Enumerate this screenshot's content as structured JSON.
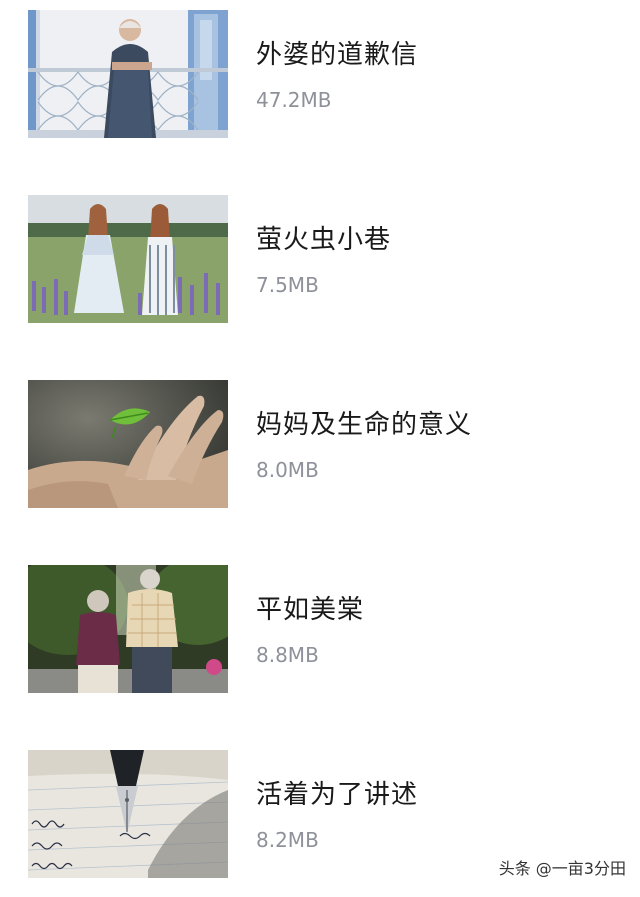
{
  "items": [
    {
      "title": "外婆的道歉信",
      "size": "47.2MB",
      "thumb_icon": "grandmother-balcony-photo"
    },
    {
      "title": "萤火虫小巷",
      "size": "7.5MB",
      "thumb_icon": "two-girls-lavender-photo"
    },
    {
      "title": "妈妈及生命的意义",
      "size": "8.0MB",
      "thumb_icon": "hand-leaf-photo"
    },
    {
      "title": "平如美棠",
      "size": "8.8MB",
      "thumb_icon": "elderly-couple-walking-photo"
    },
    {
      "title": "活着为了讲述",
      "size": "8.2MB",
      "thumb_icon": "fountain-pen-writing-photo"
    }
  ],
  "watermark": "头条 @一亩3分田"
}
